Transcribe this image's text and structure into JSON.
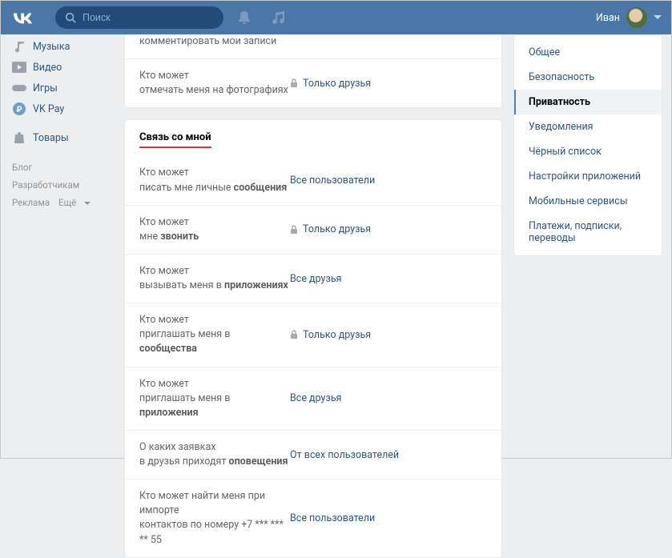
{
  "header": {
    "search_placeholder": "Поиск",
    "username": "Иван"
  },
  "left_nav": {
    "items": [
      {
        "label": "Музыка"
      },
      {
        "label": "Видео"
      },
      {
        "label": "Игры"
      },
      {
        "label": "VK Pay"
      },
      {
        "label": "Товары"
      }
    ],
    "footer": {
      "blog": "Блог",
      "devs": "Разработчикам",
      "ads": "Реклама",
      "more": "Ещё"
    }
  },
  "top_panel": {
    "rows": [
      {
        "l1": "",
        "l2": "комментировать мои записи",
        "val": ""
      },
      {
        "l1": "Кто может",
        "l2": "отмечать меня на фотографиях",
        "val": "Только друзья",
        "lock": true
      }
    ]
  },
  "section_title": "Связь со мной",
  "contact_rows": [
    {
      "l1": "Кто может",
      "l2a": "писать мне личные ",
      "bold": "сообщения",
      "val": "Все пользователи"
    },
    {
      "l1": "Кто может",
      "l2a": "мне ",
      "bold": "звонить",
      "val": "Только друзья",
      "lock": true
    },
    {
      "l1": "Кто может",
      "l2a": "вызывать меня в ",
      "bold": "приложениях",
      "val": "Все друзья"
    },
    {
      "l1": "Кто может",
      "l2a": "приглашать меня в ",
      "bold": "сообщества",
      "val": "Только друзья",
      "lock": true
    },
    {
      "l1": "Кто может",
      "l2a": "приглашать меня в ",
      "bold": "приложения",
      "val": "Все друзья"
    },
    {
      "l1": "О каких заявках",
      "l2a": "в друзья приходят ",
      "bold": "оповещения",
      "val": "От всех пользователей"
    },
    {
      "l1": "Кто может найти меня при импорте",
      "l2a": "контактов по номеру +7 *** *** ** 55",
      "bold": "",
      "val": "Все пользователи"
    }
  ],
  "right_nav": {
    "items": [
      "Общее",
      "Безопасность",
      "Приватность",
      "Уведомления",
      "Чёрный список",
      "Настройки приложений",
      "Мобильные сервисы",
      "Платежи, подписки, переводы"
    ],
    "active_index": 2
  }
}
